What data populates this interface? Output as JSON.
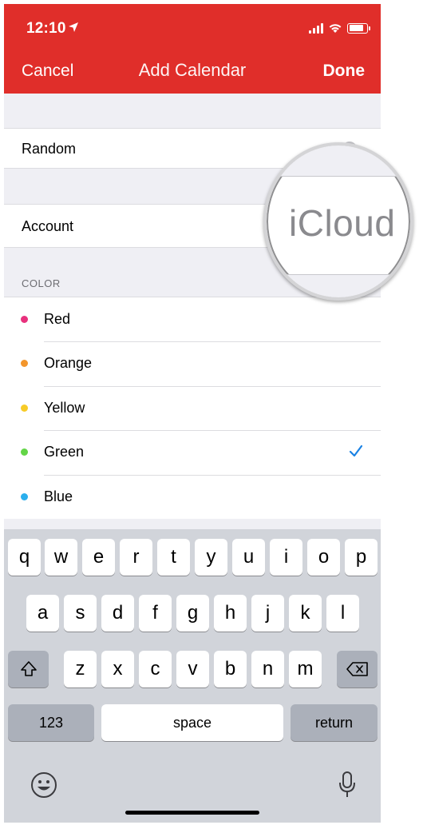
{
  "status_bar": {
    "time": "12:10",
    "icons": [
      "location-arrow-icon",
      "signal-icon",
      "wifi-icon",
      "battery-icon"
    ]
  },
  "nav": {
    "cancel": "Cancel",
    "title": "Add Calendar",
    "done": "Done"
  },
  "form": {
    "name_value": "Random",
    "account_label": "Account",
    "account_value": "iCloud",
    "color_section": "COLOR",
    "colors": [
      {
        "label": "Red",
        "hex": "#e8317d",
        "selected": false
      },
      {
        "label": "Orange",
        "hex": "#f3962c",
        "selected": false
      },
      {
        "label": "Yellow",
        "hex": "#f7cb27",
        "selected": false
      },
      {
        "label": "Green",
        "hex": "#63d547",
        "selected": true
      },
      {
        "label": "Blue",
        "hex": "#2bafed",
        "selected": false
      }
    ]
  },
  "keyboard": {
    "row1": [
      "q",
      "w",
      "e",
      "r",
      "t",
      "y",
      "u",
      "i",
      "o",
      "p"
    ],
    "row2": [
      "a",
      "s",
      "d",
      "f",
      "g",
      "h",
      "j",
      "k",
      "l"
    ],
    "row3": [
      "z",
      "x",
      "c",
      "v",
      "b",
      "n",
      "m"
    ],
    "numbers_key": "123",
    "space_key": "space",
    "return_key": "return"
  },
  "colors": {
    "header": "#e02e2a",
    "accent_check": "#1a82e4",
    "keyboard_bg": "#d1d4da"
  }
}
